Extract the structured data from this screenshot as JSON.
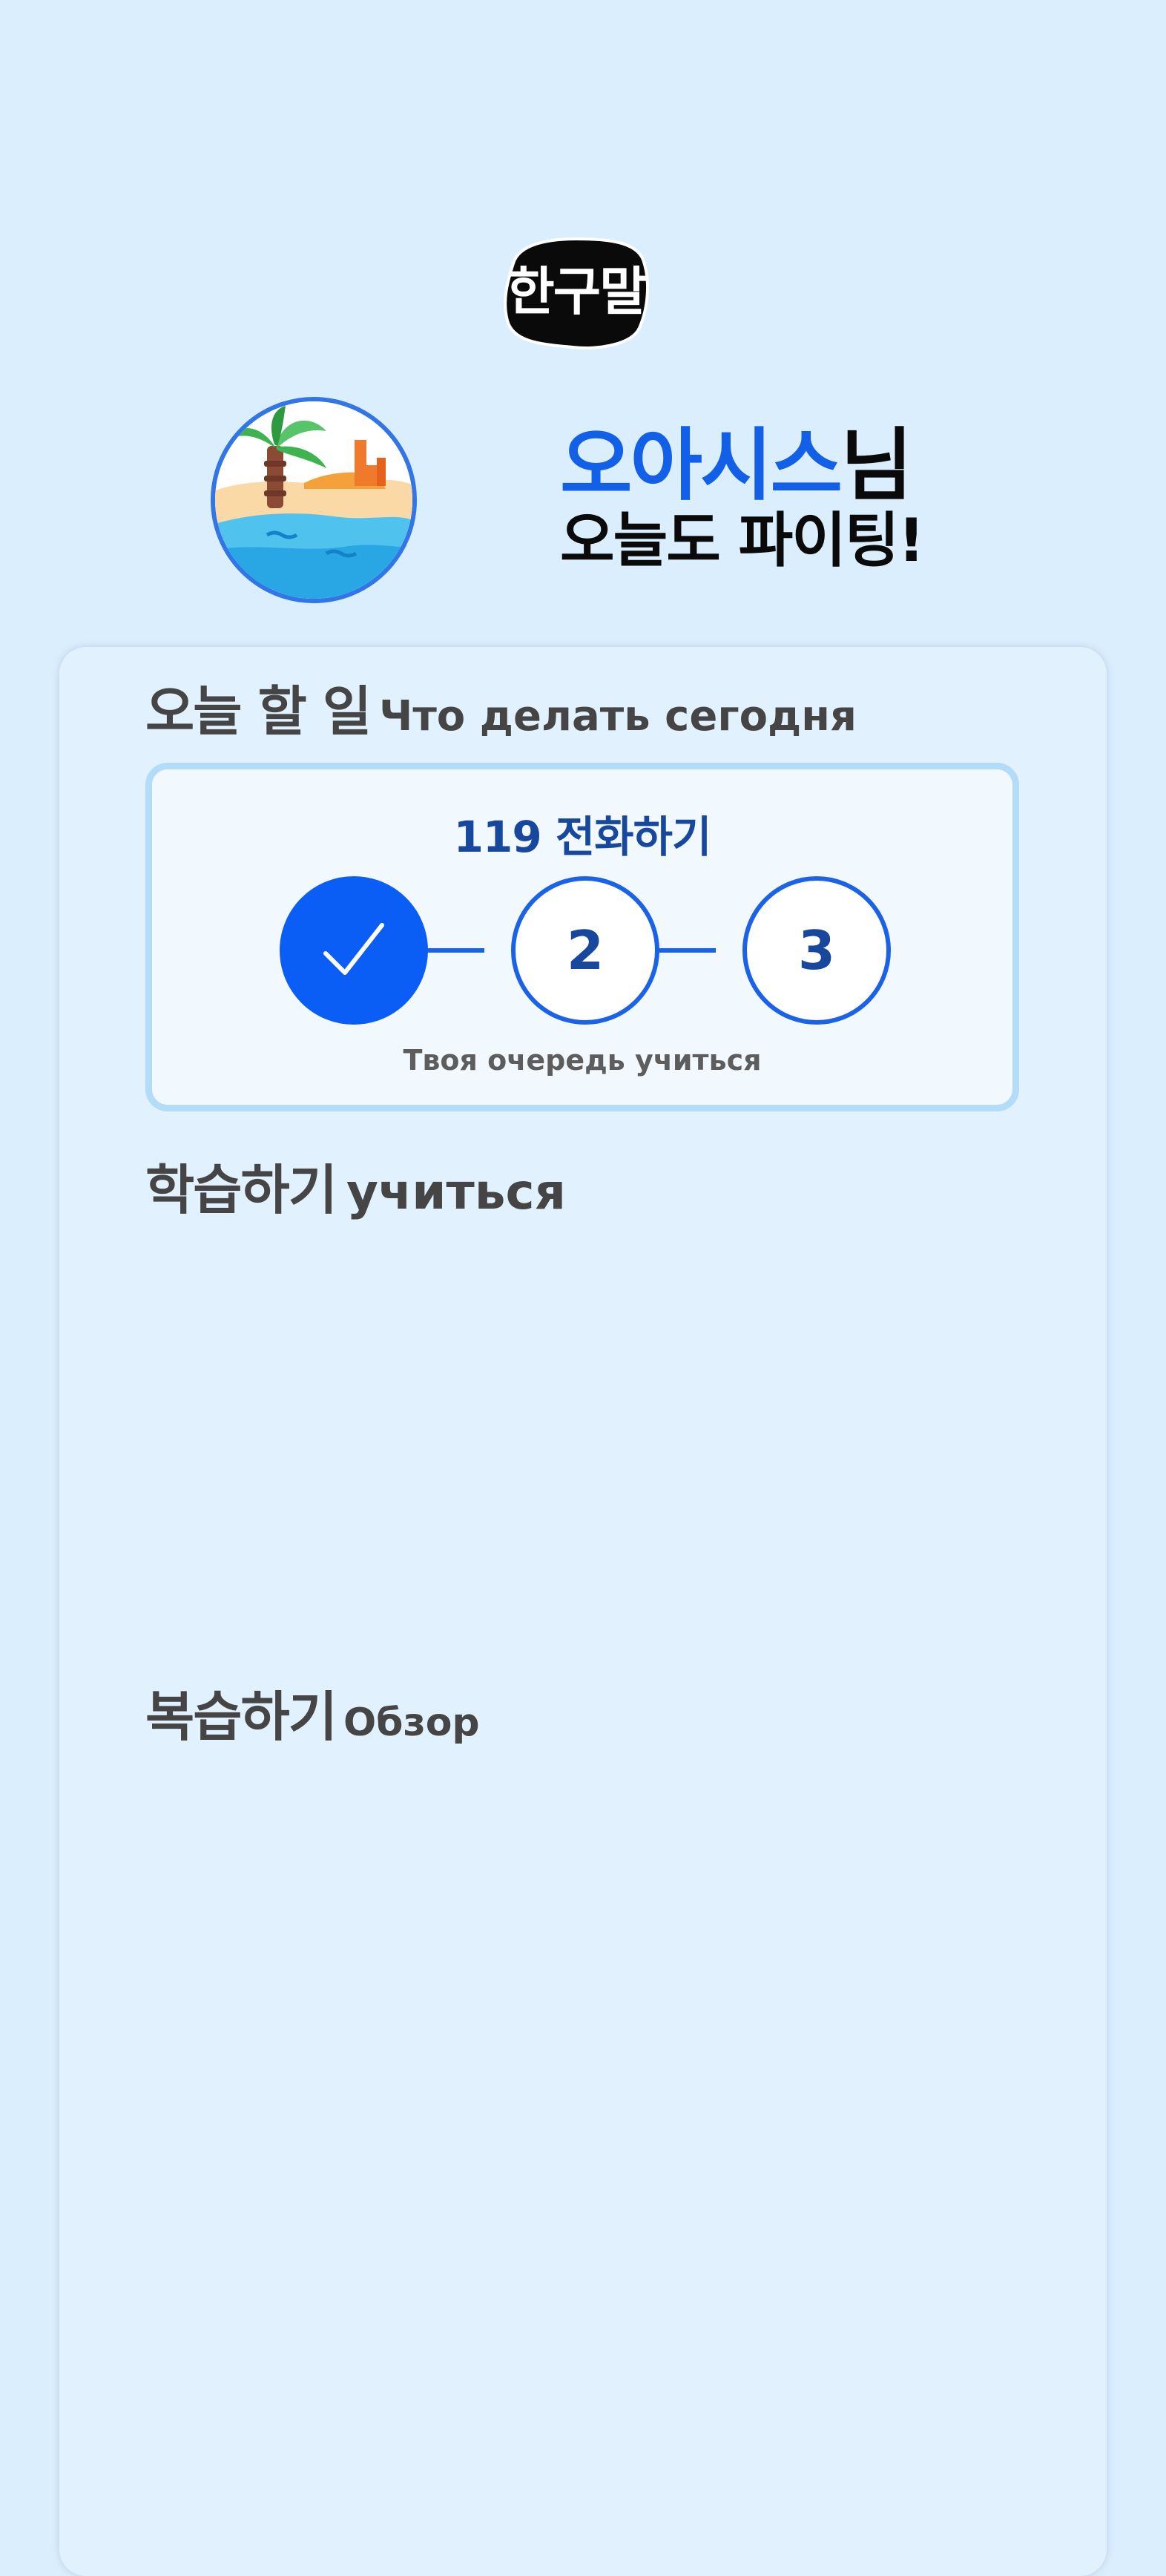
{
  "logo": {
    "text": "한구말"
  },
  "profile": {
    "name": "오아시스",
    "honorific": "님",
    "cheer": "오늘도 파이팅!",
    "avatar_icon": "beach-oasis-icon"
  },
  "today": {
    "title_ko": "오늘 할 일",
    "title_ru": "Что делать сегодня",
    "task": {
      "name": "119 전화하기",
      "steps": [
        {
          "label": "",
          "status": "done",
          "icon": "check-icon"
        },
        {
          "label": "2",
          "status": "pending"
        },
        {
          "label": "3",
          "status": "pending"
        }
      ],
      "hint": "Твоя очередь учиться"
    }
  },
  "study": {
    "title_ko": "학습하기",
    "title_ru": "учиться"
  },
  "review": {
    "title_ko": "복습하기",
    "title_ru": "Обзор"
  },
  "colors": {
    "background": "#dbeefe",
    "accent": "#0a5ef5",
    "step_text": "#17489d",
    "card": "#e2f1fe"
  }
}
